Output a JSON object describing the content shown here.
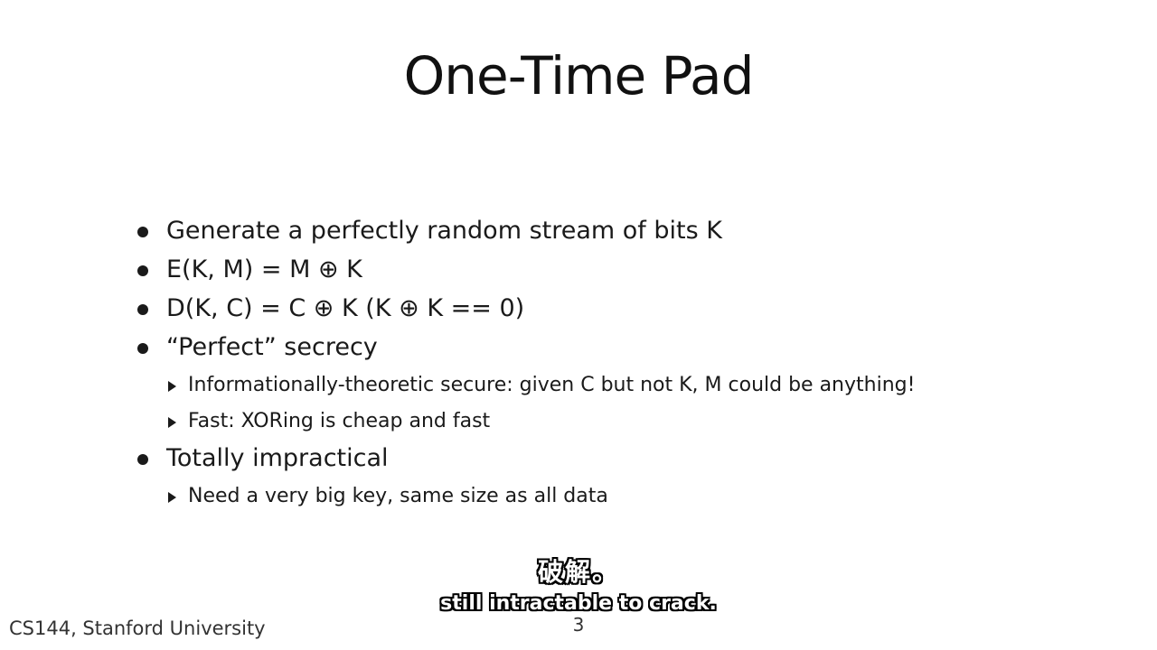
{
  "slide": {
    "title": "One-Time Pad",
    "watermark": "",
    "bullets": [
      {
        "text": "Generate a perfectly random stream of bits K"
      },
      {
        "text": "E(K, M) = M ⊕ K"
      },
      {
        "text": "D(K, C) = C ⊕ K  (K ⊕ K == 0)"
      },
      {
        "text": "“Perfect” secrecy",
        "children": [
          "Informationally-theoretic secure: given C but not K, M could be anything!",
          "Fast: XORing is cheap and fast"
        ]
      },
      {
        "text": "Totally impractical",
        "children": [
          "Need a very big key, same size as all data"
        ]
      }
    ],
    "footer": "CS144, Stanford University",
    "page_number": "3"
  },
  "subtitles": {
    "zh": "破解。",
    "en": "still intractable to crack."
  }
}
